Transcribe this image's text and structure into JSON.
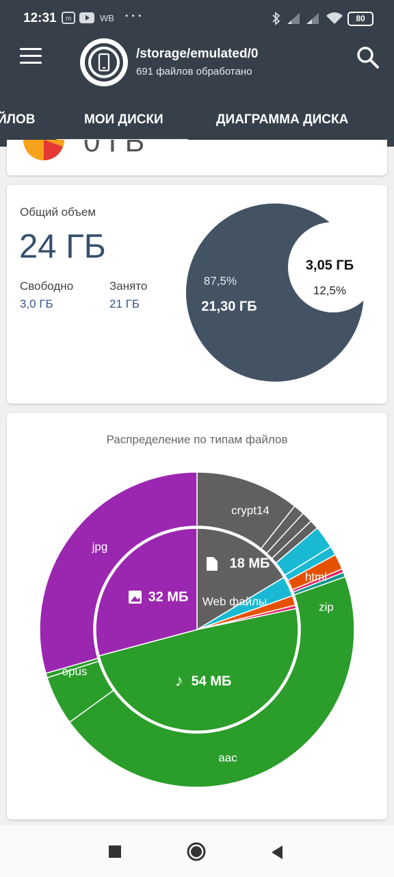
{
  "status_bar": {
    "time": "12:31",
    "icons": [
      "m-icon",
      "youtube-icon"
    ],
    "wb_label": "WB",
    "dots": "• • •",
    "battery": "80"
  },
  "header": {
    "path": "/storage/emulated/0",
    "files_processed": "691 файлов обработано"
  },
  "tabs": [
    {
      "label": "ЙЛОВ"
    },
    {
      "label": "МОИ ДИСКИ",
      "active": true
    },
    {
      "label": "ДИАГРАММА ДИСКА"
    }
  ],
  "top_card": {
    "partial_text": "0 ГБ"
  },
  "storage_card": {
    "total_label": "Общий объем",
    "total_value": "24 ГБ",
    "free_label": "Свободно",
    "free_value": "3,0 ГБ",
    "used_label": "Занято",
    "used_value": "21 ГБ",
    "used_big": "21,30 ГБ",
    "used_pct": "87,5%",
    "free_big": "3,05 ГБ",
    "free_pct": "12,5%",
    "colors": {
      "used": "#435364",
      "free": "#ffffff"
    }
  },
  "types_card": {
    "title": "Распределение по типам файлов",
    "inner_labels": {
      "images": "32 МБ",
      "documents": "18 МБ",
      "audio": "54 МБ",
      "web": "Web файлы"
    },
    "outer_labels": {
      "jpg": "jpg",
      "crypt14": "crypt14",
      "html": "html",
      "zip": "zip",
      "opus": "opus",
      "aac": "aac"
    },
    "colors": {
      "images": "#9b27b0",
      "documents": "#606060",
      "web": "#1ab9d3",
      "archives": "#e65100",
      "audio": "#2a9d2a",
      "other": "#e91e63",
      "teal": "#15988a"
    }
  },
  "chart_data": [
    {
      "type": "pie",
      "categories": [
        "Занято",
        "Свободно"
      ],
      "values": [
        87.5,
        12.5
      ],
      "value_labels": [
        "21,30 ГБ",
        "3,05 ГБ"
      ]
    },
    {
      "type": "pie",
      "title": "Распределение по типам файлов",
      "inner_ring": {
        "categories": [
          "documents",
          "web",
          "archives",
          "other",
          "audio",
          "images"
        ],
        "values": [
          18,
          3.5,
          1.7,
          0.6,
          54,
          32
        ],
        "labels": [
          "18 МБ",
          "Web файлы",
          "",
          "",
          "54 МБ",
          "32 МБ"
        ]
      },
      "outer_ring": {
        "categories": [
          "crypt14",
          "",
          "",
          "",
          "html",
          "",
          "zip",
          "",
          "",
          "aac",
          "opus",
          "",
          "jpg"
        ],
        "values": [
          11.4,
          1.2,
          1.2,
          1.0,
          2.5,
          1.0,
          1.7,
          0.4,
          0.5,
          48.6,
          5.4,
          0.5,
          31.5
        ]
      }
    }
  ]
}
